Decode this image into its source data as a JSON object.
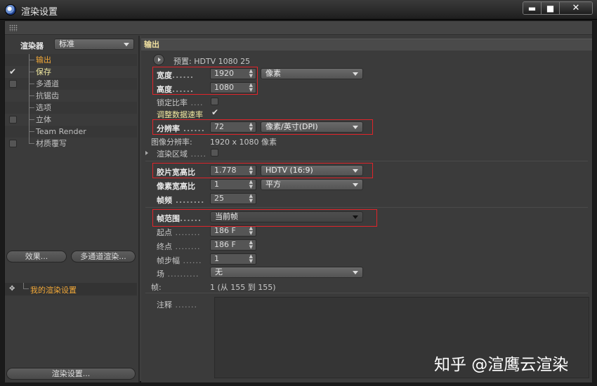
{
  "window": {
    "title": "渲染设置",
    "minimize": "▬",
    "maximize": "■",
    "close": "✕"
  },
  "left": {
    "renderer_label": "渲染器",
    "renderer_value": "标准",
    "items": [
      {
        "label": "输出",
        "checked": false,
        "has_checkbox": false,
        "state": "active"
      },
      {
        "label": "保存",
        "checked": true,
        "has_checkbox": true,
        "state": "bright"
      },
      {
        "label": "多通道",
        "checked": false,
        "has_checkbox": true,
        "state": "normal"
      },
      {
        "label": "抗锯齿",
        "checked": false,
        "has_checkbox": false,
        "state": "normal"
      },
      {
        "label": "选项",
        "checked": false,
        "has_checkbox": false,
        "state": "normal"
      },
      {
        "label": "立体",
        "checked": false,
        "has_checkbox": true,
        "state": "normal"
      },
      {
        "label": "Team Render",
        "checked": false,
        "has_checkbox": false,
        "state": "normal"
      },
      {
        "label": "材质覆写",
        "checked": false,
        "has_checkbox": true,
        "state": "normal"
      }
    ],
    "effects_button": "效果...",
    "multipass_button": "多通道渲染...",
    "my_settings": "我的渲染设置",
    "render_settings_button": "渲染设置..."
  },
  "right": {
    "section_title": "输出",
    "preset_label": "预置: HDTV 1080 25",
    "width_label": "宽度",
    "width_value": "1920",
    "width_unit": "像素",
    "height_label": "高度",
    "height_value": "1080",
    "lock_ratio_label": "锁定比率",
    "adjust_rate_label": "调整数据速率",
    "resolution_label": "分辨率",
    "resolution_value": "72",
    "resolution_unit": "像素/英寸(DPI)",
    "image_res_label": "图像分辨率:",
    "image_res_value": "1920 x 1080 像素",
    "render_region_label": "渲染区域",
    "film_aspect_label": "胶片宽高比",
    "film_aspect_value": "1.778",
    "film_aspect_preset": "HDTV (16:9)",
    "pixel_aspect_label": "像素宽高比",
    "pixel_aspect_value": "1",
    "pixel_aspect_preset": "平方",
    "frame_rate_label": "帧频",
    "frame_rate_value": "25",
    "frame_range_label": "帧范围",
    "frame_range_value": "当前帧",
    "start_label": "起点",
    "start_value": "186 F",
    "end_label": "终点",
    "end_value": "186 F",
    "step_label": "帧步幅",
    "step_value": "1",
    "field_label": "场",
    "field_value": "无",
    "frames_label": "帧:",
    "frames_value": "1 (从 155 到 155)",
    "notes_label": "注释"
  },
  "watermark": "知乎 @渲鹰云渲染",
  "colors": {
    "highlight_box": "#e0242a",
    "active_item": "#f2a838",
    "section_title": "#f0e0a0"
  }
}
